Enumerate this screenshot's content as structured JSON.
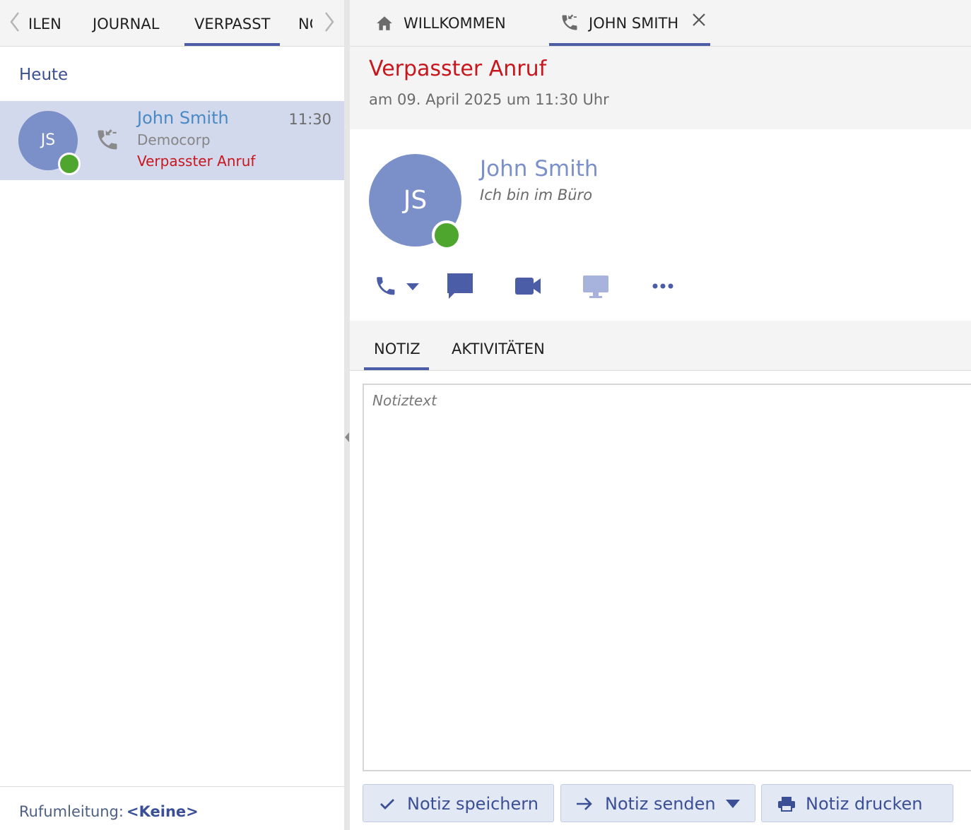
{
  "left_pane": {
    "tabs": [
      {
        "label": "ILEN"
      },
      {
        "label": "JOURNAL"
      },
      {
        "label": "VERPASST",
        "active": true
      },
      {
        "label": "NOTIZEN"
      }
    ],
    "section_heading": "Heute",
    "calls": [
      {
        "initials": "JS",
        "name": "John Smith",
        "company": "Democorp",
        "status": "Verpasster Anruf",
        "time": "11:30",
        "presence": "available",
        "icon": "missed-call-icon"
      }
    ],
    "footer": {
      "label": "Rufumleitung:",
      "value": "<Keine>"
    }
  },
  "right_pane": {
    "tabs": [
      {
        "label": "WILLKOMMEN",
        "icon": "home-icon"
      },
      {
        "label": "JOHN SMITH",
        "icon": "missed-call-icon",
        "active": true,
        "closable": true
      }
    ],
    "header": {
      "title": "Verpasster Anruf",
      "date": "am 09. April 2025 um 11:30 Uhr"
    },
    "contact": {
      "initials": "JS",
      "name": "John Smith",
      "status": "Ich bin im Büro",
      "presence": "available"
    },
    "actions": [
      "phone-icon",
      "chat-icon",
      "video-icon",
      "screen-share-icon",
      "more-icon"
    ],
    "detail_tabs": [
      {
        "label": "NOTIZ",
        "active": true
      },
      {
        "label": "AKTIVITÄTEN"
      }
    ],
    "note": {
      "placeholder": "Notiztext",
      "value": ""
    },
    "buttons": {
      "save": "Notiz speichern",
      "send": "Notiz senden",
      "print": "Notiz drucken"
    }
  },
  "colors": {
    "accent": "#4a5da6",
    "avatar": "#7b8fc9",
    "missed": "#c8161d",
    "presence_available": "#4ea62e",
    "selected_row": "#d3d9ed"
  }
}
